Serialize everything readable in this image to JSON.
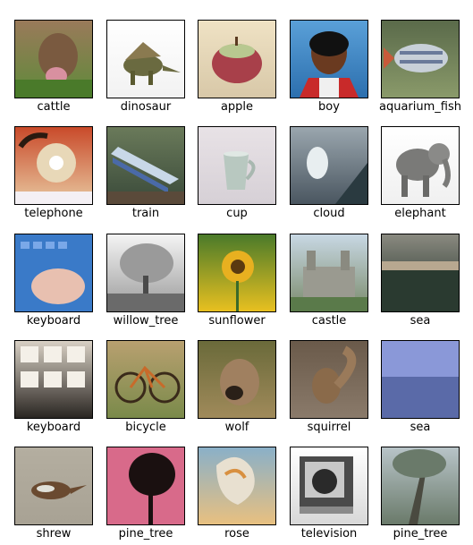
{
  "images": [
    {
      "label": "cattle",
      "bg": [
        "#9a7a5a",
        "#5f8a3a"
      ]
    },
    {
      "label": "dinosaur",
      "bg": [
        "#ffffff",
        "#f2f2f2"
      ]
    },
    {
      "label": "apple",
      "bg": [
        "#efe2c4",
        "#d8c8a8"
      ]
    },
    {
      "label": "boy",
      "bg": [
        "#5aa0d8",
        "#2c6fae"
      ]
    },
    {
      "label": "aquarium_fish",
      "bg": [
        "#5a6a4a",
        "#8a9a6a"
      ]
    },
    {
      "label": "telephone",
      "bg": [
        "#c94a2a",
        "#e8c8a0"
      ]
    },
    {
      "label": "train",
      "bg": [
        "#6a7a5a",
        "#3a4a3a"
      ]
    },
    {
      "label": "cup",
      "bg": [
        "#e8e2e6",
        "#d6d0d6"
      ]
    },
    {
      "label": "cloud",
      "bg": [
        "#9aa6ae",
        "#4a5660"
      ]
    },
    {
      "label": "elephant",
      "bg": [
        "#ffffff",
        "#f0f0f0"
      ]
    },
    {
      "label": "keyboard",
      "bg": [
        "#3a7ac8",
        "#2a5aa8"
      ]
    },
    {
      "label": "willow_tree",
      "bg": [
        "#f4f4f4",
        "#9a9a9a"
      ]
    },
    {
      "label": "sunflower",
      "bg": [
        "#4a7a2a",
        "#e8c020"
      ]
    },
    {
      "label": "castle",
      "bg": [
        "#c8d8e4",
        "#7a8a6a"
      ]
    },
    {
      "label": "sea",
      "bg": [
        "#8a8a80",
        "#1a2a22"
      ]
    },
    {
      "label": "keyboard",
      "bg": [
        "#d8d0c4",
        "#2a2622"
      ]
    },
    {
      "label": "bicycle",
      "bg": [
        "#b8a070",
        "#7a8a4a"
      ]
    },
    {
      "label": "wolf",
      "bg": [
        "#6a6a3a",
        "#a08a5a"
      ]
    },
    {
      "label": "squirrel",
      "bg": [
        "#6a5a4a",
        "#8a7a6a"
      ]
    },
    {
      "label": "sea",
      "bg": [
        "#8a9ad8",
        "#5a6ab0"
      ]
    },
    {
      "label": "shrew",
      "bg": [
        "#b4aea0",
        "#a8a294"
      ]
    },
    {
      "label": "pine_tree",
      "bg": [
        "#e07a9a",
        "#5a2a3a"
      ]
    },
    {
      "label": "rose",
      "bg": [
        "#8ab0c8",
        "#e8c080"
      ]
    },
    {
      "label": "television",
      "bg": [
        "#ffffff",
        "#d8d8d8"
      ]
    },
    {
      "label": "pine_tree",
      "bg": [
        "#b8c4c8",
        "#6a7a6a"
      ]
    }
  ]
}
